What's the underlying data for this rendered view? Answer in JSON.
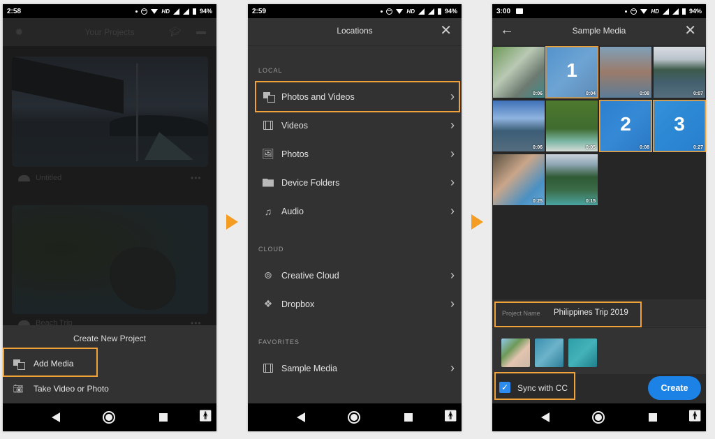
{
  "colors": {
    "highlight": "#f0a33a",
    "arrow": "#f59d23",
    "create_button": "#1d82e6",
    "checkbox": "#2d8cf0"
  },
  "status_bar": {
    "battery": "94%",
    "network": "HD"
  },
  "screens": [
    {
      "time": "2:58",
      "header": {
        "title": "Your Projects",
        "left_icon": "gear-icon",
        "right_icons": [
          "learn-icon",
          "feedback-icon"
        ]
      },
      "projects": [
        {
          "name": "Untitled",
          "icon": "cloud-icon"
        },
        {
          "name": "Beach Trip",
          "icon": "cloud-upload-icon"
        }
      ],
      "sheet": {
        "title": "Create New Project",
        "items": [
          {
            "label": "Add Media",
            "icon": "media-icon",
            "highlighted": true
          },
          {
            "label": "Take Video or Photo",
            "icon": "camera-icon",
            "highlighted": false
          }
        ]
      }
    },
    {
      "time": "2:59",
      "header": {
        "title": "Locations",
        "close_icon": "close-icon"
      },
      "sections": [
        {
          "label": "LOCAL",
          "items": [
            {
              "label": "Photos and Videos",
              "icon": "media-icon",
              "highlighted": true
            },
            {
              "label": "Videos",
              "icon": "film-icon"
            },
            {
              "label": "Photos",
              "icon": "photo-icon"
            },
            {
              "label": "Device Folders",
              "icon": "folder-icon"
            },
            {
              "label": "Audio",
              "icon": "music-icon"
            }
          ]
        },
        {
          "label": "CLOUD",
          "items": [
            {
              "label": "Creative Cloud",
              "icon": "creative-cloud-icon"
            },
            {
              "label": "Dropbox",
              "icon": "dropbox-icon"
            }
          ]
        },
        {
          "label": "FAVORITES",
          "items": [
            {
              "label": "Sample Media",
              "icon": "film-icon"
            }
          ]
        }
      ]
    },
    {
      "time": "3:00",
      "header": {
        "title": "Sample Media",
        "back_icon": "back-arrow-icon",
        "close_icon": "close-icon"
      },
      "media": [
        {
          "duration": "0:06",
          "selection": ""
        },
        {
          "duration": "0:04",
          "selection": "1"
        },
        {
          "duration": "0:08",
          "selection": ""
        },
        {
          "duration": "0:07",
          "selection": ""
        },
        {
          "duration": "0:06",
          "selection": ""
        },
        {
          "duration": "0:05",
          "selection": ""
        },
        {
          "duration": "0:08",
          "selection": "2"
        },
        {
          "duration": "0:27",
          "selection": "3"
        },
        {
          "duration": "0:25",
          "selection": ""
        },
        {
          "duration": "0:15",
          "selection": ""
        }
      ],
      "project_name": {
        "label": "Project Name",
        "value": "Philippines Trip 2019"
      },
      "selected_count": 3,
      "sync": {
        "label": "Sync with CC",
        "checked": true
      },
      "create_label": "Create"
    }
  ]
}
